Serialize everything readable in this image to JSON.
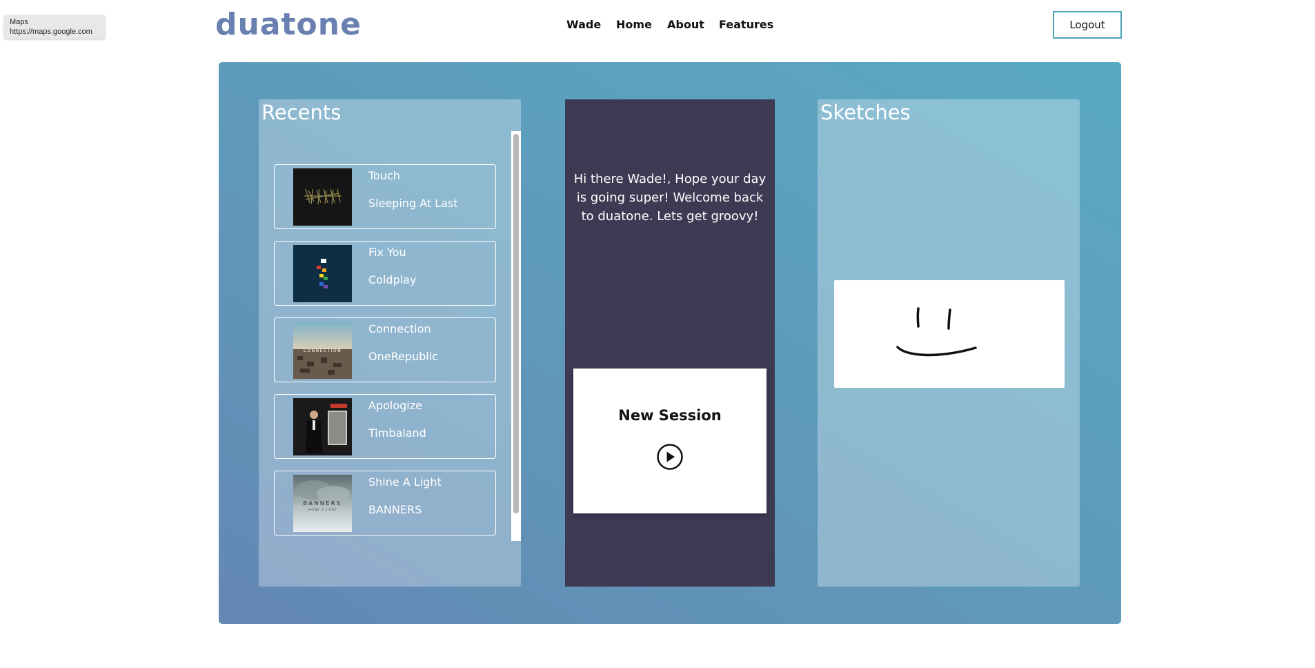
{
  "tooltip": {
    "title": "Maps",
    "url": "https://maps.google.com"
  },
  "header": {
    "logo": "duatone",
    "nav": [
      "Wade",
      "Home",
      "About",
      "Features"
    ],
    "logout": "Logout"
  },
  "recents": {
    "title": "Recents",
    "songs": [
      {
        "title": "Touch",
        "artist": "Sleeping At Last"
      },
      {
        "title": "Fix You",
        "artist": "Coldplay"
      },
      {
        "title": "Connection",
        "artist": "OneRepublic"
      },
      {
        "title": "Apologize",
        "artist": "Timbaland"
      },
      {
        "title": "Shine A Light",
        "artist": "BANNERS"
      }
    ]
  },
  "welcome": {
    "message": "Hi there Wade!, Hope your day is going super! Welcome back to duatone. Lets get groovy!",
    "session_title": "New Session"
  },
  "sketches": {
    "title": "Sketches"
  },
  "cover_art": {
    "connection": "CONNECTION",
    "banners": "BANNERS",
    "banners_sub": "SHINE A LIGHT"
  },
  "colors": {
    "accent": "#4aa3b4",
    "logo": "#6a80b0",
    "welcome_panel": "#3e3a54"
  }
}
